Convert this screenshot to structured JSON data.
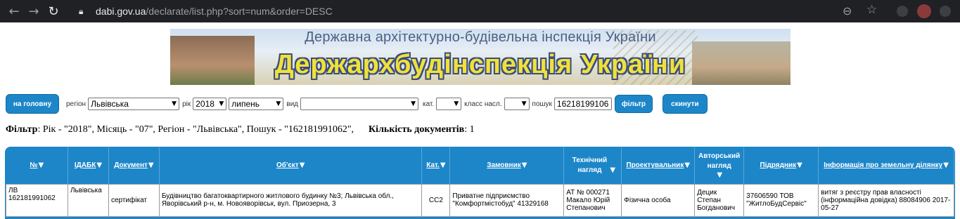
{
  "browser": {
    "url_host": "dabi.gov.ua",
    "url_path": "/declarate/list.php?sort=num&order=DESC"
  },
  "banner": {
    "subtitle": "Державна архітектурно-будівельна інспекція України",
    "title": "Держархбудінспекція України"
  },
  "filters": {
    "home_label": "на головну",
    "region_label": "регіон",
    "region_value": "Львівська",
    "year_label": "рік",
    "year_value": "2018",
    "month_value": "липень",
    "type_label": "вид",
    "type_value": "",
    "cat_label": "кат.",
    "cat_value": "",
    "class_label": "класс насл.",
    "class_value": "",
    "search_label": "пошук",
    "search_value": "16218199106",
    "filter_button": "фільтр",
    "reset_button": "скинути"
  },
  "summary": {
    "filter_label": "Фільтр",
    "filter_text": ": Рік - \"2018\", Місяць - \"07\", Регіон - \"Львівська\", Пошук - \"162181991062\",",
    "count_label": "Кількість документів",
    "count_value": ": 1"
  },
  "table": {
    "headers": [
      "№",
      "ІДАБК",
      "Документ",
      "Об'єкт",
      "Кат.",
      "Замовник",
      "Технічний нагляд",
      "Проектувальник",
      "Авторський нагляд",
      "Підрядник",
      "Інформація про земельну ділянку"
    ],
    "row": {
      "num": "ЛВ 162181991062",
      "idabk": "Львівська",
      "document": "сертифікат",
      "object": "Будівництво багатоквартирного житлового будинку №3; Львівська обл., Яворівський р-н, м. Новояворівськ, вул. Приозерна, 3",
      "cat": "СС2",
      "customer": "Приватне підприємство \"Комфортмістобуд\" 41329168",
      "tech_supervision": "АТ № 000271 Макало Юрій Степанович",
      "designer": "Фізична особа",
      "author_supervision": "Децик Степан Богданович",
      "contractor": "37606590 ТОВ \"ЖитлоБудСервіс\"",
      "land_info": "витяг з реєстру прав власності (інформаційна довідка) 88084906 2017-05-27"
    }
  }
}
